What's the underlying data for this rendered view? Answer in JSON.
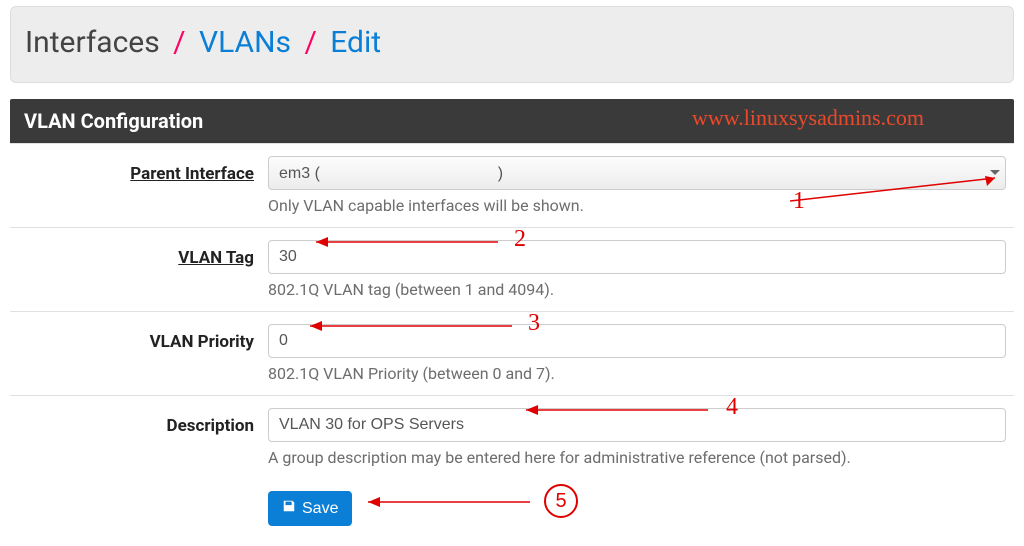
{
  "breadcrumb": {
    "root": "Interfaces",
    "mid": "VLANs",
    "leaf": "Edit"
  },
  "panel": {
    "title": "VLAN Configuration",
    "watermark": "www.linuxsysadmins.com"
  },
  "fields": {
    "parent": {
      "label": "Parent Interface",
      "value": "em3 (",
      "value_suffix": ")",
      "help": "Only VLAN capable interfaces will be shown."
    },
    "tag": {
      "label": "VLAN Tag",
      "value": "30",
      "help": "802.1Q VLAN tag (between 1 and 4094)."
    },
    "priority": {
      "label": "VLAN Priority",
      "value": "0",
      "help": "802.1Q VLAN Priority (between 0 and 7)."
    },
    "desc": {
      "label": "Description",
      "value": "VLAN 30 for OPS Servers",
      "help": "A group description may be entered here for administrative reference (not parsed)."
    }
  },
  "buttons": {
    "save": "Save"
  },
  "annotations": {
    "n1": "1",
    "n2": "2",
    "n3": "3",
    "n4": "4",
    "n5": "5"
  }
}
